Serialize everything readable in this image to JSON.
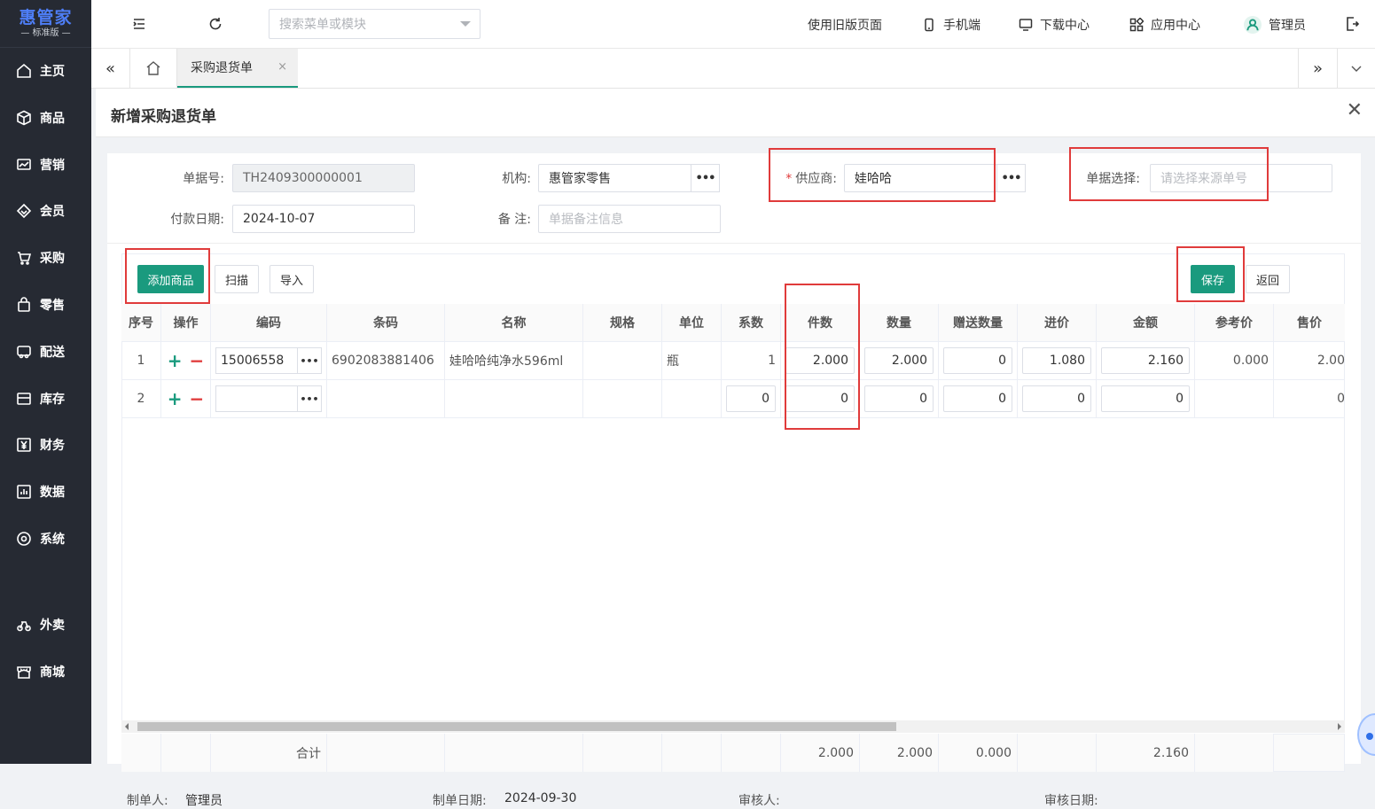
{
  "logo": {
    "title": "惠管家",
    "subtitle": "— 标准版 —"
  },
  "sidebar": {
    "items": [
      {
        "label": "主页",
        "icon": "home-icon"
      },
      {
        "label": "商品",
        "icon": "box-icon"
      },
      {
        "label": "营销",
        "icon": "chart-icon"
      },
      {
        "label": "会员",
        "icon": "diamond-icon"
      },
      {
        "label": "采购",
        "icon": "cart-icon"
      },
      {
        "label": "零售",
        "icon": "bag-icon"
      },
      {
        "label": "配送",
        "icon": "truck-icon"
      },
      {
        "label": "库存",
        "icon": "warehouse-icon"
      },
      {
        "label": "财务",
        "icon": "yuan-icon"
      },
      {
        "label": "数据",
        "icon": "data-icon"
      },
      {
        "label": "系统",
        "icon": "settings-icon"
      },
      {
        "label": "外卖",
        "icon": "delivery-icon"
      },
      {
        "label": "商城",
        "icon": "store-icon"
      }
    ]
  },
  "topbar": {
    "search_placeholder": "搜索菜单或模块",
    "old_page": "使用旧版页面",
    "mobile": "手机端",
    "download": "下载中心",
    "apps": "应用中心",
    "user": "管理员"
  },
  "tabs": {
    "active": "采购退货单",
    "close": "×"
  },
  "page": {
    "title": "新增采购退货单",
    "close": "✕"
  },
  "form": {
    "doc_no_label": "单据号:",
    "doc_no": "TH2409300000001",
    "org_label": "机构:",
    "org": "惠管家零售",
    "supplier_required": "*",
    "supplier_label": "供应商:",
    "supplier": "娃哈哈",
    "source_label": "单据选择:",
    "source_placeholder": "请选择来源单号",
    "pay_date_label": "付款日期:",
    "pay_date": "2024-10-07",
    "remark_label": "备 注:",
    "remark_placeholder": "单据备注信息",
    "dots": "•••"
  },
  "toolbar": {
    "add": "添加商品",
    "scan": "扫描",
    "import": "导入",
    "save": "保存",
    "back": "返回"
  },
  "table": {
    "headers": [
      "序号",
      "操作",
      "编码",
      "条码",
      "名称",
      "规格",
      "单位",
      "系数",
      "件数",
      "数量",
      "赠送数量",
      "进价",
      "金额",
      "参考价",
      "售价"
    ],
    "rows": [
      {
        "no": "1",
        "code": "15006558",
        "barcode": "6902083881406",
        "name": "娃哈哈纯净水596ml",
        "spec": "",
        "unit": "瓶",
        "coef": "1",
        "pieces": "2.000",
        "qty": "2.000",
        "gift": "0",
        "price": "1.080",
        "amount": "2.160",
        "ref": "0.000",
        "sale": "2.00"
      },
      {
        "no": "2",
        "code": "",
        "barcode": "",
        "name": "",
        "spec": "",
        "unit": "",
        "coef": "0",
        "pieces": "0",
        "qty": "0",
        "gift": "0",
        "price": "0",
        "amount": "0",
        "ref": "",
        "sale": "0"
      }
    ],
    "plus": "+",
    "minus": "−",
    "footer": {
      "label": "合计",
      "pieces": "2.000",
      "qty": "2.000",
      "gift": "0.000",
      "amount": "2.160"
    }
  },
  "bottom": {
    "creator_label": "制单人:",
    "creator": "管理员",
    "date_label": "制单日期:",
    "date": "2024-09-30",
    "auditor_label": "审核人:",
    "audit_date_label": "审核日期:"
  },
  "colors": {
    "primary": "#1a9a7e",
    "sidebar": "#262a33",
    "highlight": "#e03b3b",
    "logo": "#4e7ef7"
  }
}
